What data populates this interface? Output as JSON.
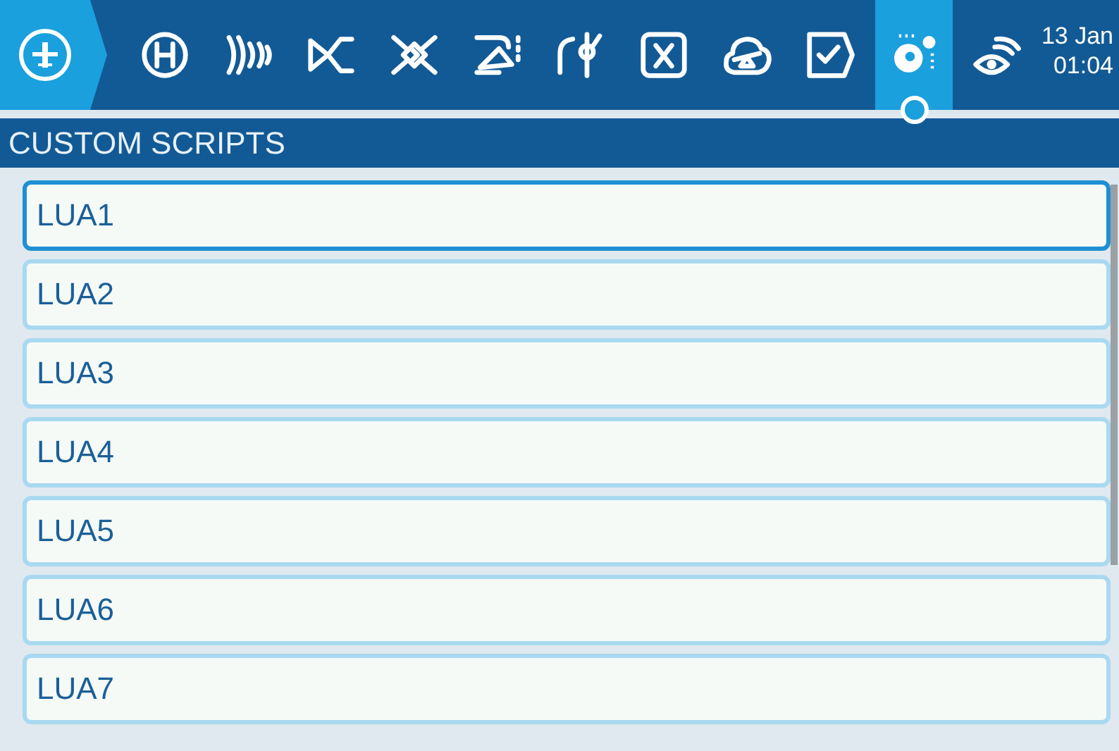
{
  "top_bar": {
    "tabs": [
      {
        "selected": false
      },
      {
        "selected": false
      },
      {
        "selected": false
      },
      {
        "selected": false
      },
      {
        "selected": false
      },
      {
        "selected": false
      },
      {
        "selected": false
      },
      {
        "selected": false
      },
      {
        "selected": false
      },
      {
        "selected": true
      },
      {
        "selected": false
      }
    ],
    "date": "13 Jan",
    "time": "01:04"
  },
  "page_title": "CUSTOM SCRIPTS",
  "scripts": [
    {
      "label": "LUA1",
      "focused": true
    },
    {
      "label": "LUA2",
      "focused": false
    },
    {
      "label": "LUA3",
      "focused": false
    },
    {
      "label": "LUA4",
      "focused": false
    },
    {
      "label": "LUA5",
      "focused": false
    },
    {
      "label": "LUA6",
      "focused": false
    },
    {
      "label": "LUA7",
      "focused": false
    }
  ]
}
